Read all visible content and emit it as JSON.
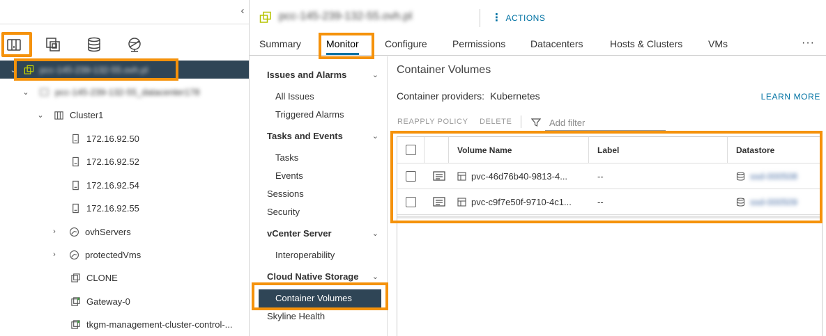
{
  "left_panel": {
    "collapse_glyph": "‹",
    "view_icons": [
      "hosts-and-clusters-icon",
      "vms-and-templates-icon",
      "storage-icon",
      "networking-icon"
    ],
    "tree": [
      {
        "label": "pcc-145-239-132-55.ovh.pl",
        "level": 0,
        "expanded": true,
        "icon": "vcenter-icon",
        "selected": true,
        "blurred": true
      },
      {
        "label": "pcc-145-239-132-55_datacenter178",
        "level": 1,
        "expanded": true,
        "icon": "datacenter-icon",
        "blurred": true
      },
      {
        "label": "Cluster1",
        "level": 2,
        "expanded": true,
        "icon": "cluster-icon"
      },
      {
        "label": "172.16.92.50",
        "level": 3,
        "icon": "host-icon"
      },
      {
        "label": "172.16.92.52",
        "level": 3,
        "icon": "host-icon"
      },
      {
        "label": "172.16.92.54",
        "level": 3,
        "icon": "host-icon"
      },
      {
        "label": "172.16.92.55",
        "level": 3,
        "icon": "host-icon"
      },
      {
        "label": "ovhServers",
        "level": 2,
        "collapsed": true,
        "icon": "resource-pool-icon"
      },
      {
        "label": "protectedVms",
        "level": 2,
        "collapsed": true,
        "icon": "resource-pool-icon"
      },
      {
        "label": "CLONE",
        "level": 2,
        "icon": "vm-icon"
      },
      {
        "label": "Gateway-0",
        "level": 2,
        "icon": "vm-running-icon"
      },
      {
        "label": "tkgm-management-cluster-control-...",
        "level": 2,
        "icon": "vm-running-icon"
      }
    ]
  },
  "header": {
    "title": "pcc-145-239-132-55.ovh.pl",
    "actions_label": "ACTIONS",
    "tabs": [
      "Summary",
      "Monitor",
      "Configure",
      "Permissions",
      "Datacenters",
      "Hosts & Clusters",
      "VMs"
    ],
    "active_tab": "Monitor",
    "more_glyph": "···"
  },
  "subnav": {
    "issues_group": "Issues and Alarms",
    "all_issues": "All Issues",
    "triggered_alarms": "Triggered Alarms",
    "tasks_group": "Tasks and Events",
    "tasks": "Tasks",
    "events": "Events",
    "sessions": "Sessions",
    "security": "Security",
    "vcenter_group": "vCenter Server",
    "interoperability": "Interoperability",
    "cns_group": "Cloud Native Storage",
    "container_volumes": "Container Volumes",
    "skyline_health": "Skyline Health"
  },
  "content": {
    "title": "Container Volumes",
    "providers_label": "Container providers:",
    "providers_value": "Kubernetes",
    "learn_more": "LEARN MORE",
    "reapply_policy": "REAPPLY POLICY",
    "delete": "DELETE",
    "filter_placeholder": "Add filter",
    "columns": {
      "volume_name": "Volume Name",
      "label": "Label",
      "datastore": "Datastore"
    },
    "rows": [
      {
        "volume_name": "pvc-46d76b40-9813-4...",
        "label": "--",
        "datastore": "ssd-000508"
      },
      {
        "volume_name": "pvc-c9f7e50f-9710-4c1...",
        "label": "--",
        "datastore": "ssd-000509"
      }
    ]
  },
  "colors": {
    "highlight": "#f5920b",
    "selected_bg": "#2f4556",
    "link": "#0072a3"
  }
}
